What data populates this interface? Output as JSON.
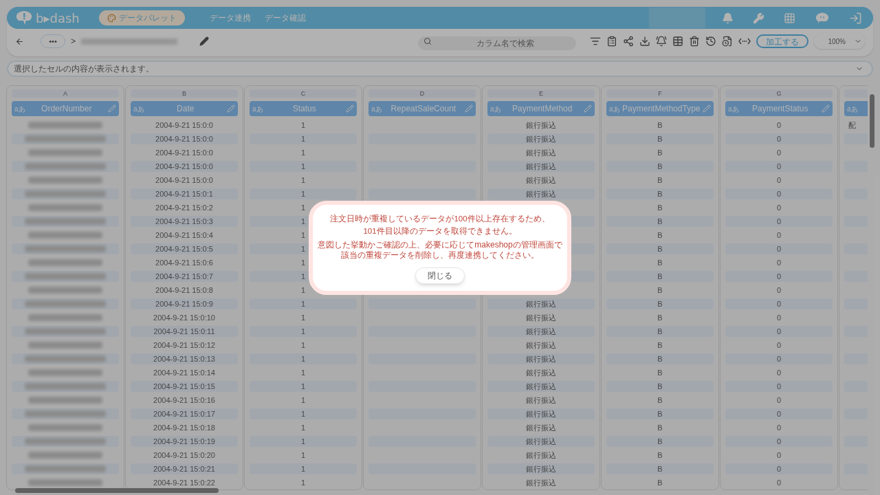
{
  "header": {
    "logo": "b▸dash",
    "app_pill": "データパレット",
    "nav": [
      "データ連携",
      "データ確認"
    ]
  },
  "toolbar": {
    "more": "•••",
    "separator": ">",
    "search": {
      "placeholder": "カラム名で検索"
    },
    "process_button": "加工する",
    "zoom": "100%"
  },
  "cell_viewer": {
    "placeholder": "選択したセルの内容が表示されます。"
  },
  "columns": [
    {
      "letter": "A",
      "type_label": "aあ",
      "name": "OrderNumber",
      "kind": "redacted"
    },
    {
      "letter": "B",
      "type_label": "aあ",
      "name": "Date",
      "kind": "text",
      "cells": [
        "2004-9-21 15:0:0",
        "2004-9-21 15:0:0",
        "2004-9-21 15:0:0",
        "2004-9-21 15:0:0",
        "2004-9-21 15:0:0",
        "2004-9-21 15:0:1",
        "2004-9-21 15:0:2",
        "2004-9-21 15:0:3",
        "2004-9-21 15:0:4",
        "2004-9-21 15:0:5",
        "2004-9-21 15:0:6",
        "2004-9-21 15:0:7",
        "2004-9-21 15:0:8",
        "2004-9-21 15:0:9",
        "2004-9-21 15:0:10",
        "2004-9-21 15:0:11",
        "2004-9-21 15:0:12",
        "2004-9-21 15:0:13",
        "2004-9-21 15:0:14",
        "2004-9-21 15:0:15",
        "2004-9-21 15:0:16",
        "2004-9-21 15:0:17",
        "2004-9-21 15:0:18",
        "2004-9-21 15:0:19",
        "2004-9-21 15:0:20",
        "2004-9-21 15:0:21",
        "2004-9-21 15:0:22"
      ]
    },
    {
      "letter": "C",
      "type_label": "aあ",
      "name": "Status",
      "kind": "text",
      "cells": [
        "1",
        "1",
        "1",
        "1",
        "1",
        "1",
        "1",
        "1",
        "1",
        "1",
        "1",
        "1",
        "1",
        "1",
        "1",
        "1",
        "1",
        "1",
        "1",
        "1",
        "1",
        "1",
        "1",
        "1",
        "1",
        "1",
        "1"
      ]
    },
    {
      "letter": "D",
      "type_label": "aあ",
      "name": "RepeatSaleCount",
      "kind": "text",
      "cells": [
        null,
        null,
        null,
        null,
        null,
        null,
        null,
        null,
        null,
        null,
        null,
        null,
        null,
        null,
        null,
        null,
        null,
        null,
        null,
        null,
        null,
        null,
        null,
        null,
        null,
        null,
        null
      ]
    },
    {
      "letter": "E",
      "type_label": "aあ",
      "name": "PaymentMethod",
      "kind": "text",
      "cells": [
        "銀行振込",
        "銀行振込",
        "銀行振込",
        "銀行振込",
        "銀行振込",
        "銀行振込",
        null,
        null,
        null,
        null,
        null,
        null,
        null,
        "銀行振込",
        "銀行振込",
        "銀行振込",
        "銀行振込",
        "銀行振込",
        "銀行振込",
        "銀行振込",
        "銀行振込",
        "銀行振込",
        "銀行振込",
        "銀行振込",
        "銀行振込",
        "銀行振込",
        "銀行振込"
      ]
    },
    {
      "letter": "F",
      "type_label": "aあ",
      "name": "PaymentMethodType",
      "kind": "text",
      "cells": [
        "B",
        "B",
        "B",
        "B",
        "B",
        "B",
        "B",
        "B",
        "B",
        "B",
        "B",
        "B",
        "B",
        "B",
        "B",
        "B",
        "B",
        "B",
        "B",
        "B",
        "B",
        "B",
        "B",
        "B",
        "B",
        "B",
        "B"
      ]
    },
    {
      "letter": "G",
      "type_label": "aあ",
      "name": "PaymentStatus",
      "kind": "text",
      "cells": [
        "0",
        "0",
        "0",
        "0",
        "0",
        "0",
        "0",
        "0",
        "0",
        "0",
        "0",
        "0",
        "0",
        "0",
        "0",
        "0",
        "0",
        "0",
        "0",
        "0",
        "0",
        "0",
        "0",
        "0",
        "0",
        "0",
        "0"
      ]
    },
    {
      "type_label": "aあ",
      "kind": "partial",
      "cells": [
        "配",
        null,
        null,
        null,
        null,
        null,
        null,
        null,
        null,
        null,
        null,
        null,
        null,
        null,
        null,
        null,
        null,
        null,
        null,
        null,
        null,
        null,
        null,
        null,
        null,
        null,
        null
      ]
    }
  ],
  "dialog": {
    "message": [
      "注文日時が重複しているデータが100件以上存在するため、",
      "101件目以降のデータを取得できません。"
    ],
    "detail": [
      "意図した挙動かご確認の上、必要に応じてmakeshopの管理画面で",
      "該当の重複データを削除し、再度連携してください。"
    ],
    "button": "閉じる"
  }
}
